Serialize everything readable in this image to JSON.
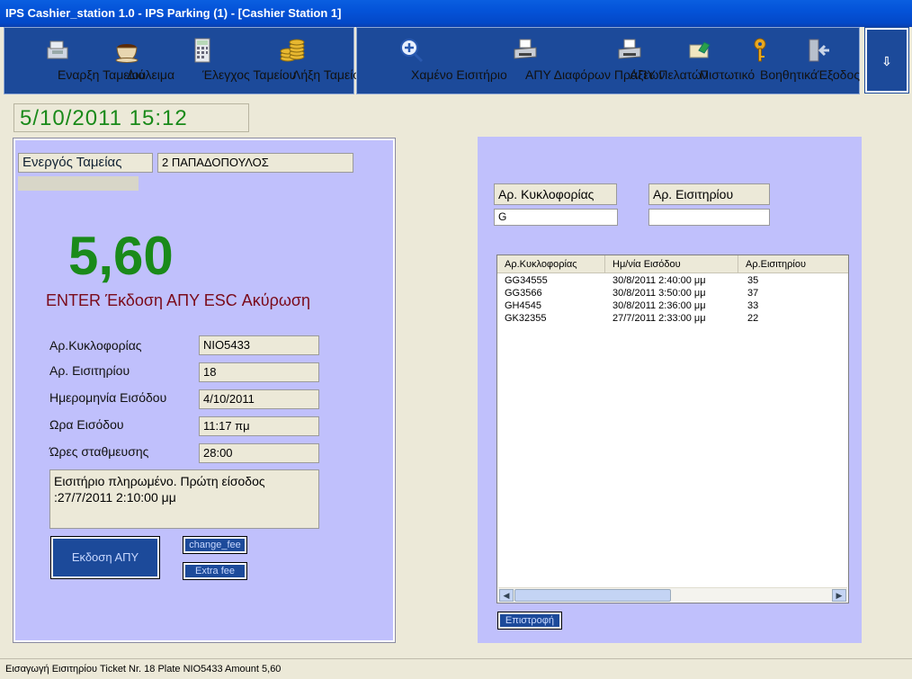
{
  "window": {
    "title": "IPS Cashier_station 1.0 - IPS Parking (1) - [Cashier Station 1]"
  },
  "toolbar_left": [
    {
      "label": "Εναρξη Ταμείου",
      "icon": "cash-register-icon"
    },
    {
      "label": "Διάλειμα",
      "icon": "coffee-cup-icon"
    },
    {
      "label": "Έλεγχος Ταμείου",
      "icon": "calculator-icon"
    },
    {
      "label": "Λήξη Ταμείου",
      "icon": "coins-icon"
    }
  ],
  "toolbar_right": [
    {
      "label": "Χαμένο Εισιτήριο",
      "icon": "magnify-plus-icon"
    },
    {
      "label": "ΑΠΥ Διαφόρων Πράξεων",
      "icon": "printer-icon"
    },
    {
      "label": "ΑΠΥ Πελατών",
      "icon": "printer-icon"
    },
    {
      "label": "Πιστωτικό",
      "icon": "credit-note-icon"
    },
    {
      "label": "Βοηθητικά",
      "icon": "key-icon"
    },
    {
      "label": "Έξοδος",
      "icon": "exit-door-icon"
    }
  ],
  "arrow_button": "⇩",
  "datetime": "5/10/2011   15:12",
  "cashier": {
    "label": "Ενεργός Ταμείας",
    "value": "2 ΠΑΠΑΔΟΠΟΥΛΟΣ"
  },
  "amount": "5,60",
  "hint": "ENTER Έκδοση ΑΠΥ   ESC Ακύρωση",
  "ticket": {
    "plate_label": "Αρ.Κυκλοφορίας",
    "plate_value": "NIO5433",
    "ticket_label": "Αρ. Εισιτηρίου",
    "ticket_value": "18",
    "date_label": "Ημερομηνία Εισόδου",
    "date_value": "4/10/2011",
    "time_label": "Ωρα Εισόδου",
    "time_value": "11:17 πμ",
    "hours_label": "Ώρες σταθμευσης",
    "hours_value": "28:00",
    "note": "Εισιτήριο πληρωμένο.  Πρώτη είσοδος :27/7/2011 2:10:00 μμ"
  },
  "buttons": {
    "issue": "Εκδοση ΑΠΥ",
    "change_fee": "change_fee",
    "extra_fee": "Extra fee",
    "back": "Επιστροφή"
  },
  "search": {
    "plate_label": "Αρ. Κυκλοφορίας",
    "plate_value": "G",
    "ticket_label": "Αρ. Εισιτηρίου",
    "ticket_value": ""
  },
  "list": {
    "columns": [
      "Αρ.Κυκλοφορίας",
      "Ημ/νία Εισόδου",
      "Αρ.Εισιτηρίου"
    ],
    "rows": [
      [
        "GG34555",
        "30/8/2011 2:40:00 μμ",
        "35"
      ],
      [
        "GG3566",
        "30/8/2011 3:50:00 μμ",
        "37"
      ],
      [
        "GH4545",
        "30/8/2011 2:36:00 μμ",
        "33"
      ],
      [
        "GK32355",
        "27/7/2011 2:33:00 μμ",
        "22"
      ]
    ]
  },
  "status": "Εισαγωγή Εισιτηρίου Ticket Nr. 18 Plate NIO5433 Amount 5,60",
  "colors": {
    "toolbar": "#1c4a9a",
    "panel": "#c0c0fc",
    "amount": "#1a8a1a",
    "hint": "#7a0a1a"
  }
}
